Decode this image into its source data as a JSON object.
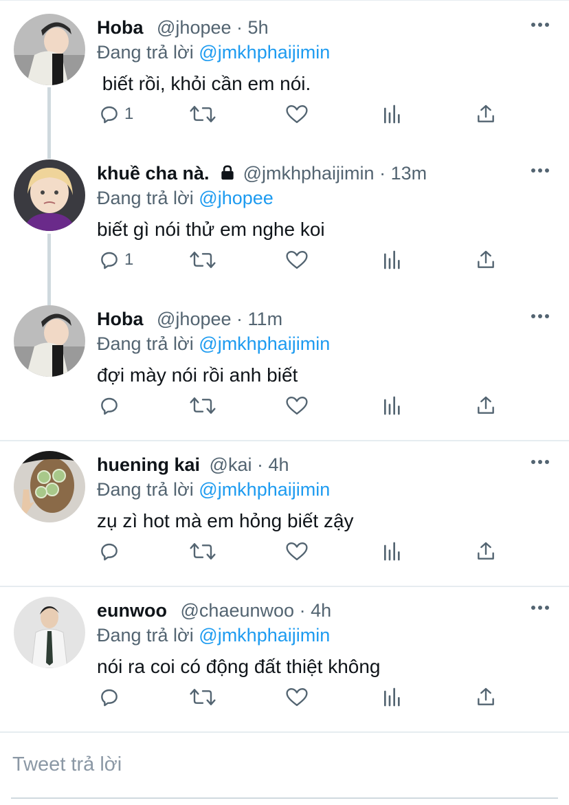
{
  "reply_box": {
    "placeholder": "Tweet trả lời"
  },
  "tweets": [
    {
      "name": "Hoba",
      "handle": "@jhopee",
      "dot": "·",
      "time": "5h",
      "reply_prefix": "Đang trả lời",
      "reply_to": "@jmkhphaijimin",
      "text": " biết rồi, khỏi cần em nói.",
      "reply_count": "1"
    },
    {
      "name": "khuề cha nà.",
      "handle": "@jmkhphaijimin",
      "dot": "·",
      "time": "13m",
      "reply_prefix": "Đang trả lời",
      "reply_to": "@jhopee",
      "text": "biết gì nói thử em nghe koi",
      "reply_count": "1",
      "locked": true
    },
    {
      "name": "Hoba",
      "handle": "@jhopee",
      "dot": "·",
      "time": "11m",
      "reply_prefix": "Đang trả lời",
      "reply_to": "@jmkhphaijimin",
      "text": "đợi mày nói rồi anh biết",
      "reply_count": ""
    },
    {
      "name": "huening kai",
      "handle": "@kai",
      "dot": "·",
      "time": "4h",
      "reply_prefix": "Đang trả lời",
      "reply_to": "@jmkhphaijimin",
      "text": "zụ zì hot mà em hỏng biết zậy",
      "reply_count": ""
    },
    {
      "name": "eunwoo",
      "handle": "@chaeunwoo",
      "dot": "·",
      "time": "4h",
      "reply_prefix": "Đang trả lời",
      "reply_to": "@jmkhphaijimin",
      "text": "nói ra coi có động đất thiệt không",
      "reply_count": ""
    }
  ],
  "icons": {
    "reply": "speech-bubble-icon",
    "retweet": "retweet-icon",
    "like": "heart-icon",
    "views": "bar-chart-icon",
    "share": "share-upload-icon",
    "more": "more-dots-icon",
    "lock": "lock-icon"
  },
  "colors": {
    "mention": "#1d9bf0",
    "muted": "#536471",
    "thread_line": "#cfd9de",
    "divider": "#e6ecf0"
  }
}
